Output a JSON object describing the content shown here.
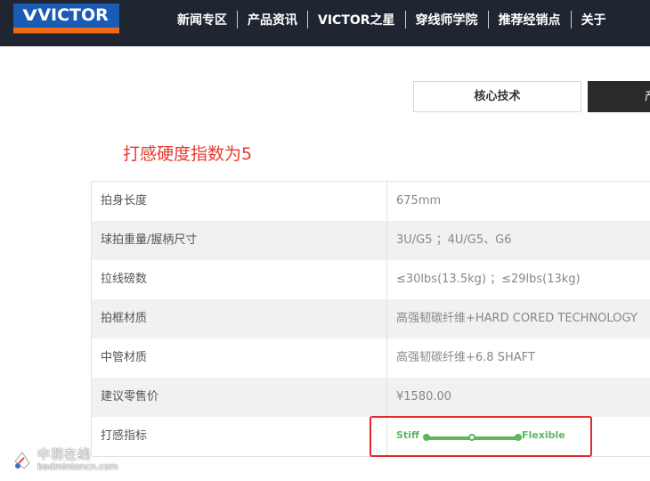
{
  "header": {
    "logo_text": "VICTOR",
    "nav": [
      "新闻专区",
      "产品资讯",
      "VICTOR之星",
      "穿线师学院",
      "推荐经销点",
      "关于"
    ]
  },
  "tabs": {
    "core": "核心技术",
    "next": "产"
  },
  "heading": "打感硬度指数为5",
  "specs": [
    {
      "label": "拍身长度",
      "value": "675mm"
    },
    {
      "label": "球拍重量/握柄尺寸",
      "value": "3U/G5 ；4U/G5、G6"
    },
    {
      "label": "拉线磅数",
      "value": "≤30lbs(13.5kg) ；≤29lbs(13kg)"
    },
    {
      "label": "拍框材质",
      "value": "高强韧碳纤维+HARD CORED TECHNOLOGY"
    },
    {
      "label": "中管材质",
      "value": "高强韧碳纤维+6.8 SHAFT"
    },
    {
      "label": "建议零售价",
      "value": "¥1580.00"
    }
  ],
  "hardness": {
    "label": "打感指标",
    "stiff": "Stiff",
    "flexible": "Flexible",
    "color": "#5cb85c",
    "dots": [
      "filled",
      "hollow",
      "filled"
    ]
  },
  "watermark": {
    "cn": "中羽在线",
    "en": "badmintoncn.com"
  },
  "colors": {
    "topbar": "#1f2632",
    "logo_blue": "#1a5bb5",
    "logo_orange": "#ee6a18",
    "heading": "#e53a2c",
    "highlight": "#e0272b"
  }
}
